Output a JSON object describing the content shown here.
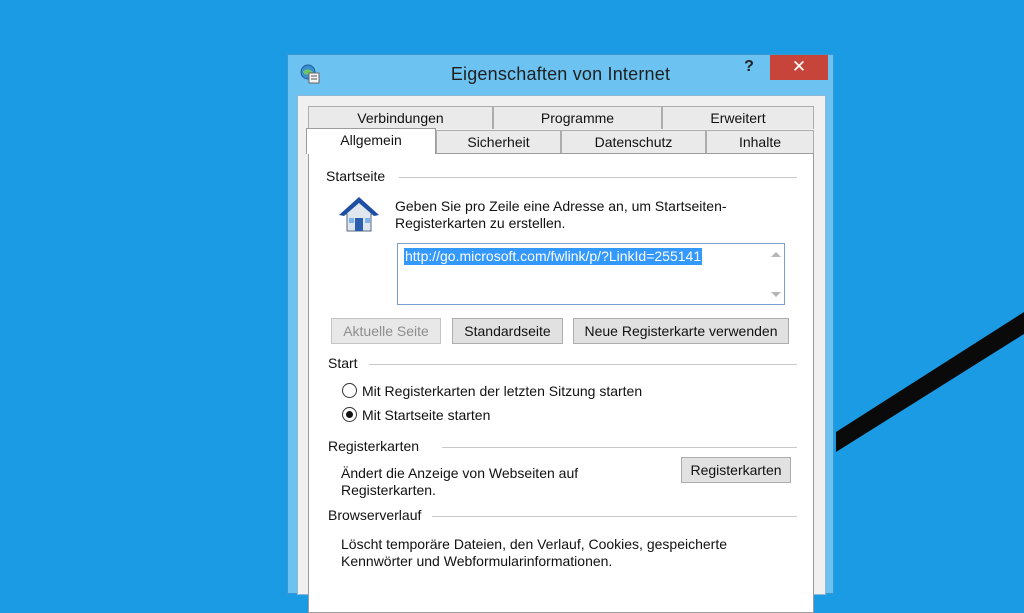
{
  "window": {
    "title": "Eigenschaften von Internet",
    "help_label": "?",
    "close_label": "✕"
  },
  "tabs": {
    "row1": [
      "Verbindungen",
      "Programme",
      "Erweitert"
    ],
    "row2": [
      "Allgemein",
      "Sicherheit",
      "Datenschutz",
      "Inhalte"
    ],
    "active": "Allgemein"
  },
  "homepage": {
    "group_label": "Startseite",
    "description_line1": "Geben Sie pro Zeile eine Adresse an, um Startseiten-",
    "description_line2": "Registerkarten zu erstellen.",
    "url_value": "http://go.microsoft.com/fwlink/p/?LinkId=255141",
    "btn_current": "Aktuelle Seite",
    "btn_default": "Standardseite",
    "btn_newtab": "Neue Registerkarte verwenden"
  },
  "start": {
    "group_label": "Start",
    "option1": "Mit Registerkarten der letzten Sitzung starten",
    "option2": "Mit Startseite starten",
    "selected": "option2"
  },
  "tabsection": {
    "group_label": "Registerkarten",
    "description_line1": "Ändert die Anzeige von Webseiten auf",
    "description_line2": "Registerkarten.",
    "button": "Registerkarten"
  },
  "history": {
    "group_label": "Browserverlauf",
    "description_line1": "Löscht temporäre Dateien, den Verlauf, Cookies, gespeicherte",
    "description_line2": "Kennwörter und Webformularinformationen."
  },
  "colors": {
    "desktop": "#1a9be3",
    "titlebar": "#6cc3f2",
    "close": "#c7443a",
    "selection": "#3399ff"
  }
}
